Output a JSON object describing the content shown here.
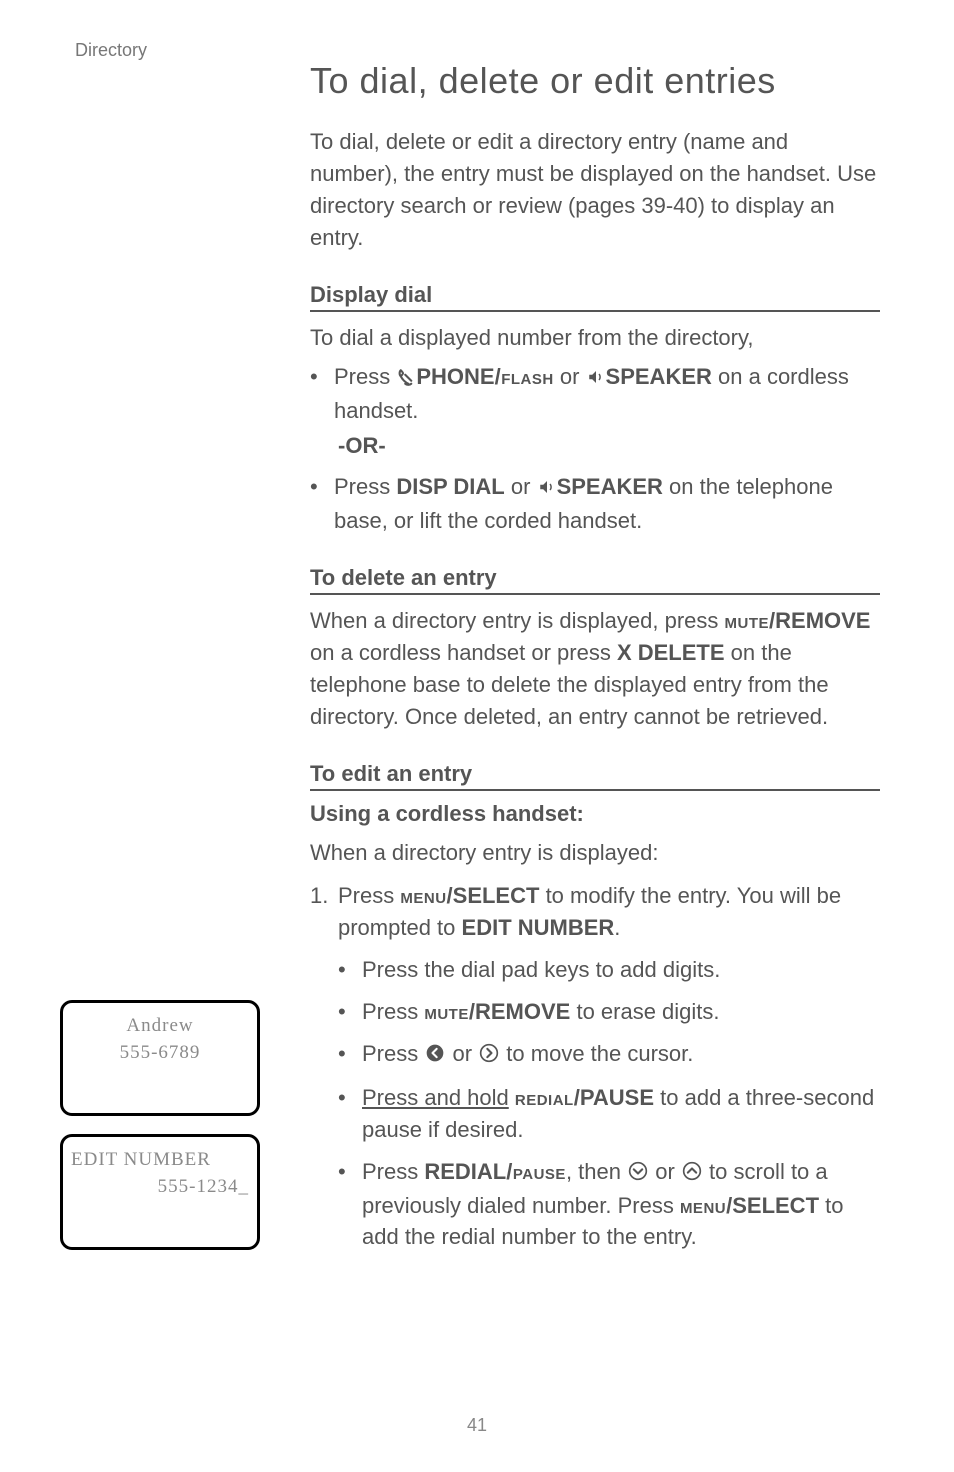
{
  "header_category": "Directory",
  "title": "To dial, delete or edit entries",
  "intro": "To dial, delete or edit a directory entry (name and number), the entry must be displayed on the handset. Use directory search or review (pages 39-40) to display an entry.",
  "sections": {
    "display_dial": {
      "head": "Display dial",
      "lead": "To dial a displayed number from the directory,",
      "bullet1_pre": "Press ",
      "bullet1_phone": "PHONE",
      "bullet1_flash": "/FLASH",
      "bullet1_mid": " or ",
      "bullet1_speaker": "SPEAKER",
      "bullet1_post": " on a cordless handset.",
      "or": "-OR-",
      "bullet2_pre": "Press ",
      "bullet2_disp": "DISP DIAL",
      "bullet2_mid": " or ",
      "bullet2_speaker": "SPEAKER",
      "bullet2_post": " on the telephone base, or lift the corded handset."
    },
    "delete": {
      "head": "To delete an entry",
      "p_pre": "When a directory entry is displayed, press ",
      "p_mute": "MUTE",
      "p_remove": "/REMOVE",
      "p_mid1": " on a cordless handset or press ",
      "p_xdelete": "X DELETE",
      "p_mid2": " on the telephone base to delete the displayed entry from the directory. Once deleted, an entry cannot be retrieved."
    },
    "edit": {
      "head": "To edit an entry",
      "subhead": "Using a cordless handset:",
      "lead": "When a directory entry is displayed:",
      "step1_num": "1.",
      "step1_pre": "Press ",
      "step1_menu": "MENU",
      "step1_select": "/SELECT",
      "step1_mid": " to modify the entry. You will be prompted to ",
      "step1_editnum": "EDIT NUMBER",
      "step1_post": ".",
      "sb1": "Press the dial pad keys to add digits.",
      "sb2_pre": "Press ",
      "sb2_mute": "MUTE",
      "sb2_remove": "/REMOVE",
      "sb2_post": " to erase digits.",
      "sb3_pre": "Press ",
      "sb3_mid": " or ",
      "sb3_post": " to move the cursor.",
      "sb4_pre": "Press and hold",
      "sb4_redial": "REDIAL",
      "sb4_pause": "/PAUSE",
      "sb4_post": " to add a three-second pause if desired.",
      "sb5_pre": "Press ",
      "sb5_redial": "REDIAL",
      "sb5_pause": "/PAUSE",
      "sb5_mid1": ", then  ",
      "sb5_mid2": " or ",
      "sb5_mid3": "  to scroll to a previously dialed number. Press ",
      "sb5_menu": "MENU",
      "sb5_select": "/SELECT",
      "sb5_post": " to add the redial number to the entry."
    }
  },
  "lcd": {
    "box1": {
      "line1": "Andrew",
      "line2": "555-6789"
    },
    "box2": {
      "line1": "EDIT NUMBER",
      "line2": "555-1234_"
    }
  },
  "page_num": "41"
}
